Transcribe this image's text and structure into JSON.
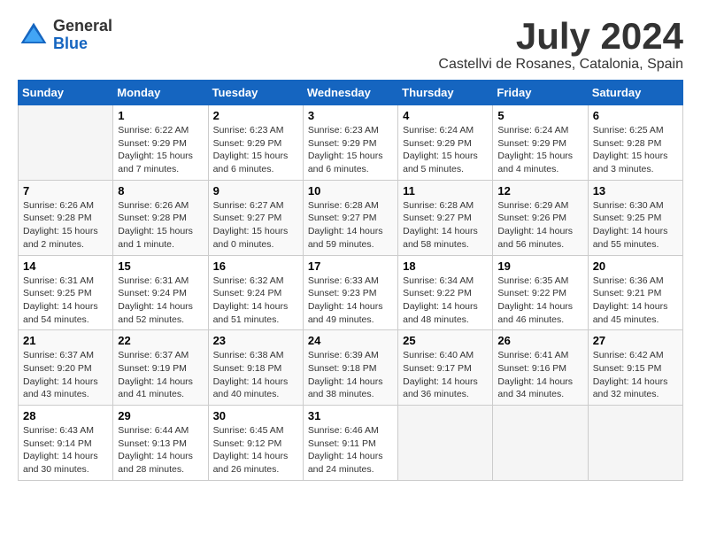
{
  "header": {
    "logo_general": "General",
    "logo_blue": "Blue",
    "month_title": "July 2024",
    "location": "Castellvi de Rosanes, Catalonia, Spain"
  },
  "days_of_week": [
    "Sunday",
    "Monday",
    "Tuesday",
    "Wednesday",
    "Thursday",
    "Friday",
    "Saturday"
  ],
  "weeks": [
    [
      {
        "day": "",
        "info": ""
      },
      {
        "day": "1",
        "info": "Sunrise: 6:22 AM\nSunset: 9:29 PM\nDaylight: 15 hours\nand 7 minutes."
      },
      {
        "day": "2",
        "info": "Sunrise: 6:23 AM\nSunset: 9:29 PM\nDaylight: 15 hours\nand 6 minutes."
      },
      {
        "day": "3",
        "info": "Sunrise: 6:23 AM\nSunset: 9:29 PM\nDaylight: 15 hours\nand 6 minutes."
      },
      {
        "day": "4",
        "info": "Sunrise: 6:24 AM\nSunset: 9:29 PM\nDaylight: 15 hours\nand 5 minutes."
      },
      {
        "day": "5",
        "info": "Sunrise: 6:24 AM\nSunset: 9:29 PM\nDaylight: 15 hours\nand 4 minutes."
      },
      {
        "day": "6",
        "info": "Sunrise: 6:25 AM\nSunset: 9:28 PM\nDaylight: 15 hours\nand 3 minutes."
      }
    ],
    [
      {
        "day": "7",
        "info": "Sunrise: 6:26 AM\nSunset: 9:28 PM\nDaylight: 15 hours\nand 2 minutes."
      },
      {
        "day": "8",
        "info": "Sunrise: 6:26 AM\nSunset: 9:28 PM\nDaylight: 15 hours\nand 1 minute."
      },
      {
        "day": "9",
        "info": "Sunrise: 6:27 AM\nSunset: 9:27 PM\nDaylight: 15 hours\nand 0 minutes."
      },
      {
        "day": "10",
        "info": "Sunrise: 6:28 AM\nSunset: 9:27 PM\nDaylight: 14 hours\nand 59 minutes."
      },
      {
        "day": "11",
        "info": "Sunrise: 6:28 AM\nSunset: 9:27 PM\nDaylight: 14 hours\nand 58 minutes."
      },
      {
        "day": "12",
        "info": "Sunrise: 6:29 AM\nSunset: 9:26 PM\nDaylight: 14 hours\nand 56 minutes."
      },
      {
        "day": "13",
        "info": "Sunrise: 6:30 AM\nSunset: 9:25 PM\nDaylight: 14 hours\nand 55 minutes."
      }
    ],
    [
      {
        "day": "14",
        "info": "Sunrise: 6:31 AM\nSunset: 9:25 PM\nDaylight: 14 hours\nand 54 minutes."
      },
      {
        "day": "15",
        "info": "Sunrise: 6:31 AM\nSunset: 9:24 PM\nDaylight: 14 hours\nand 52 minutes."
      },
      {
        "day": "16",
        "info": "Sunrise: 6:32 AM\nSunset: 9:24 PM\nDaylight: 14 hours\nand 51 minutes."
      },
      {
        "day": "17",
        "info": "Sunrise: 6:33 AM\nSunset: 9:23 PM\nDaylight: 14 hours\nand 49 minutes."
      },
      {
        "day": "18",
        "info": "Sunrise: 6:34 AM\nSunset: 9:22 PM\nDaylight: 14 hours\nand 48 minutes."
      },
      {
        "day": "19",
        "info": "Sunrise: 6:35 AM\nSunset: 9:22 PM\nDaylight: 14 hours\nand 46 minutes."
      },
      {
        "day": "20",
        "info": "Sunrise: 6:36 AM\nSunset: 9:21 PM\nDaylight: 14 hours\nand 45 minutes."
      }
    ],
    [
      {
        "day": "21",
        "info": "Sunrise: 6:37 AM\nSunset: 9:20 PM\nDaylight: 14 hours\nand 43 minutes."
      },
      {
        "day": "22",
        "info": "Sunrise: 6:37 AM\nSunset: 9:19 PM\nDaylight: 14 hours\nand 41 minutes."
      },
      {
        "day": "23",
        "info": "Sunrise: 6:38 AM\nSunset: 9:18 PM\nDaylight: 14 hours\nand 40 minutes."
      },
      {
        "day": "24",
        "info": "Sunrise: 6:39 AM\nSunset: 9:18 PM\nDaylight: 14 hours\nand 38 minutes."
      },
      {
        "day": "25",
        "info": "Sunrise: 6:40 AM\nSunset: 9:17 PM\nDaylight: 14 hours\nand 36 minutes."
      },
      {
        "day": "26",
        "info": "Sunrise: 6:41 AM\nSunset: 9:16 PM\nDaylight: 14 hours\nand 34 minutes."
      },
      {
        "day": "27",
        "info": "Sunrise: 6:42 AM\nSunset: 9:15 PM\nDaylight: 14 hours\nand 32 minutes."
      }
    ],
    [
      {
        "day": "28",
        "info": "Sunrise: 6:43 AM\nSunset: 9:14 PM\nDaylight: 14 hours\nand 30 minutes."
      },
      {
        "day": "29",
        "info": "Sunrise: 6:44 AM\nSunset: 9:13 PM\nDaylight: 14 hours\nand 28 minutes."
      },
      {
        "day": "30",
        "info": "Sunrise: 6:45 AM\nSunset: 9:12 PM\nDaylight: 14 hours\nand 26 minutes."
      },
      {
        "day": "31",
        "info": "Sunrise: 6:46 AM\nSunset: 9:11 PM\nDaylight: 14 hours\nand 24 minutes."
      },
      {
        "day": "",
        "info": ""
      },
      {
        "day": "",
        "info": ""
      },
      {
        "day": "",
        "info": ""
      }
    ]
  ]
}
